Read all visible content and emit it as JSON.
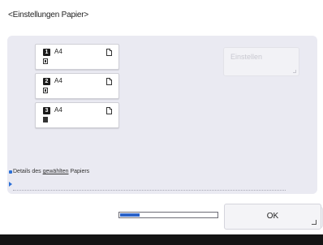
{
  "page": {
    "title": "<Einstellungen Papier>"
  },
  "trays": [
    {
      "number": "1",
      "size": "A4"
    },
    {
      "number": "2",
      "size": "A4"
    },
    {
      "number": "3",
      "size": "A4"
    }
  ],
  "buttons": {
    "settings_label": "Einstellen",
    "ok_label": "OK"
  },
  "details": {
    "prefix": "Details des ",
    "underlined": "gewählten",
    "suffix": " Papiers"
  },
  "progress": {
    "fraction": 0.2
  },
  "colors": {
    "accent": "#2b6fd6",
    "panel": "#eaeaf2",
    "footer": "#141414"
  }
}
